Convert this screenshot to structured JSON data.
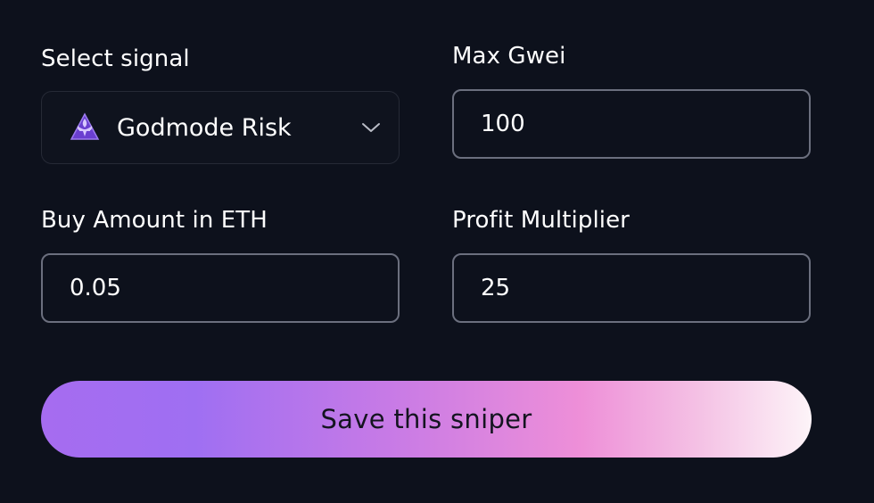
{
  "signal": {
    "label": "Select signal",
    "selected": "Godmode Risk",
    "icon": "fleur-de-lis-icon",
    "icon_color": "#7b4be0"
  },
  "max_gwei": {
    "label": "Max Gwei",
    "value": "100"
  },
  "buy_amount": {
    "label": "Buy Amount in ETH",
    "value": "0.05"
  },
  "profit_multiplier": {
    "label": "Profit Multiplier",
    "value": "25"
  },
  "save_button": {
    "label": "Save this sniper"
  },
  "colors": {
    "background": "#0d111c",
    "input_border": "#6b6f7e",
    "gradient_start": "#a66cf0",
    "gradient_mid": "#ee8fd8",
    "gradient_end": "#fdf4f8"
  }
}
